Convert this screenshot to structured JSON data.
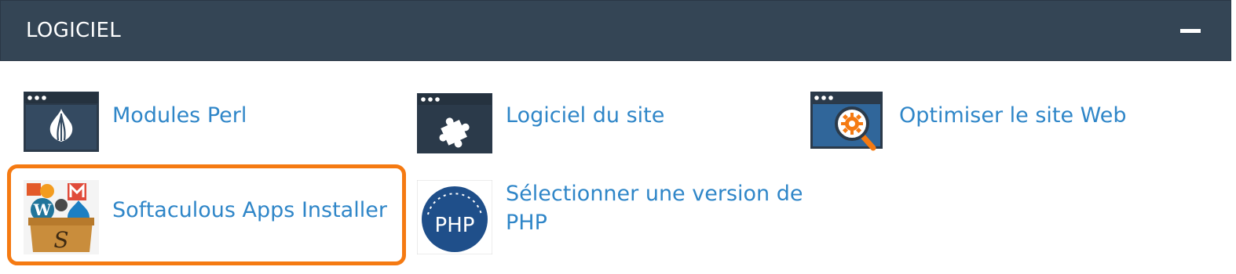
{
  "section": {
    "title": "LOGICIEL",
    "collapse_icon": "minus-icon"
  },
  "items": {
    "perl": {
      "label": "Modules Perl",
      "icon": "onion-icon"
    },
    "site_software": {
      "label": "Logiciel du site",
      "icon": "puzzle-icon"
    },
    "optimize": {
      "label": "Optimiser le site Web",
      "icon": "magnifier-gear-icon"
    },
    "softaculous": {
      "label": "Softaculous Apps Installer",
      "icon": "softaculous-box-icon"
    },
    "php": {
      "label_line1": "Sélectionner une version de",
      "label_line2": "PHP",
      "icon": "php-gauge-icon",
      "icon_text": "PHP"
    }
  },
  "colors": {
    "header_bg": "#344555",
    "link": "#2f86c8",
    "highlight": "#f57a12",
    "window_icon_bg": "#2b3a4a"
  }
}
